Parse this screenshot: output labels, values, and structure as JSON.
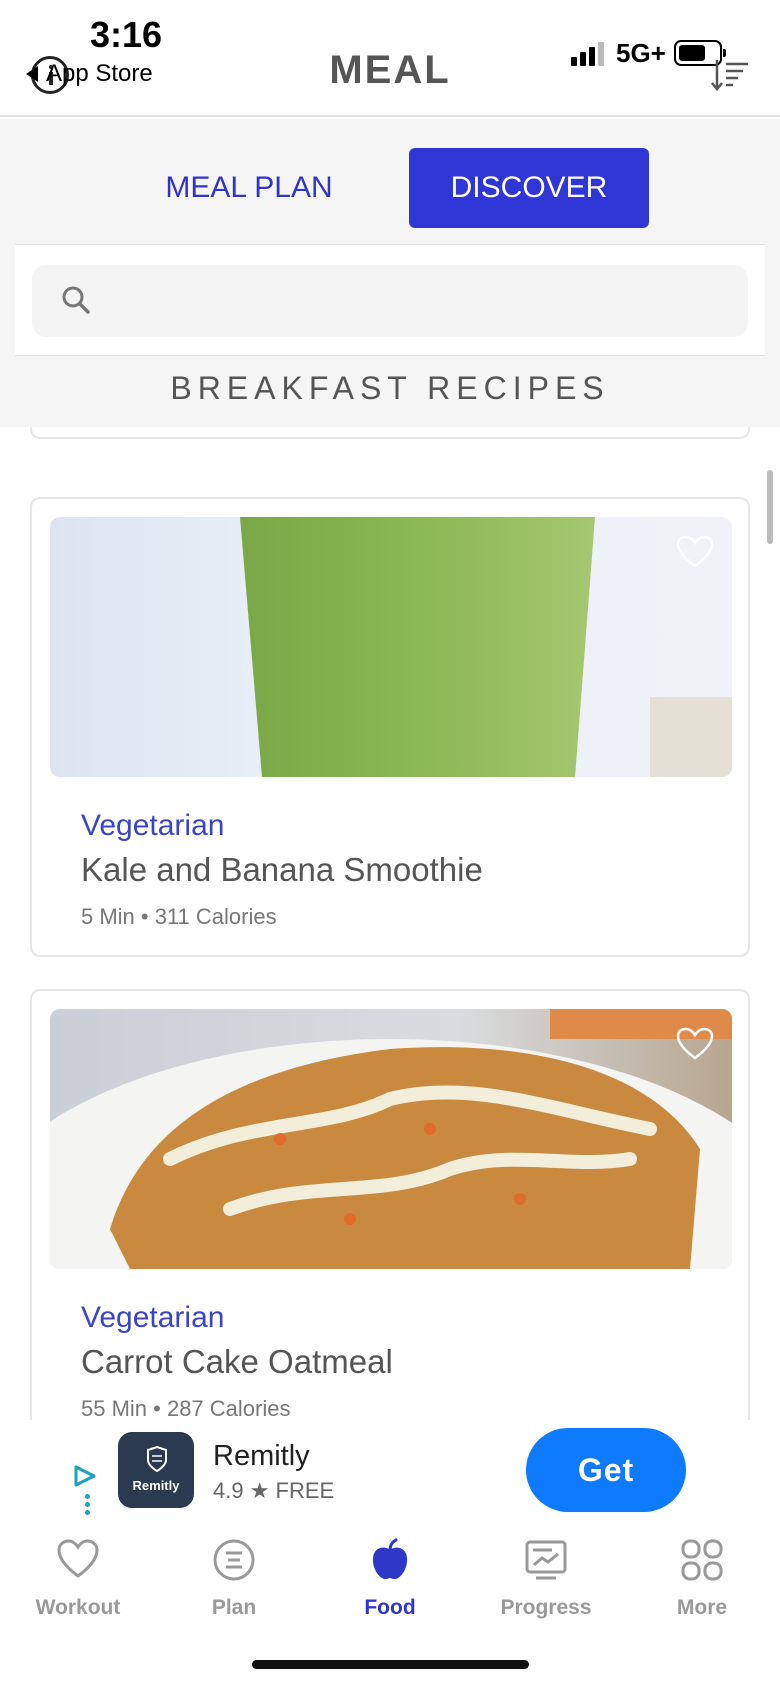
{
  "status_bar": {
    "time": "3:16",
    "back_label": "App Store",
    "network": "5G+"
  },
  "header": {
    "title": "MEAL"
  },
  "tabs": [
    {
      "label": "MEAL PLAN",
      "selected": false
    },
    {
      "label": "DISCOVER",
      "selected": true
    }
  ],
  "search": {
    "placeholder": "",
    "value": ""
  },
  "section": {
    "title": "BREAKFAST RECIPES"
  },
  "recipes": [
    {
      "tag": "Vegetarian",
      "name": "Kale and Banana Smoothie",
      "meta": "5 Min • 311 Calories",
      "image": "green-smoothie-photo"
    },
    {
      "tag": "Vegetarian",
      "name": "Carrot Cake Oatmeal",
      "meta": "55 Min • 287 Calories",
      "image": "baked-oatmeal-photo"
    }
  ],
  "ad": {
    "app_name": "Remitly",
    "logo_text": "Remitly",
    "rating": "4.9 ★ FREE",
    "button_label": "Get"
  },
  "bottom_nav": [
    {
      "label": "Workout",
      "icon": "heart-icon",
      "active": false
    },
    {
      "label": "Plan",
      "icon": "plan-icon",
      "active": false
    },
    {
      "label": "Food",
      "icon": "apple-icon",
      "active": true
    },
    {
      "label": "Progress",
      "icon": "progress-icon",
      "active": false
    },
    {
      "label": "More",
      "icon": "grid-icon",
      "active": false
    }
  ],
  "colors": {
    "accent": "#3035d5",
    "accent_text": "#3a45c6",
    "ad_button": "#0e7bff"
  }
}
